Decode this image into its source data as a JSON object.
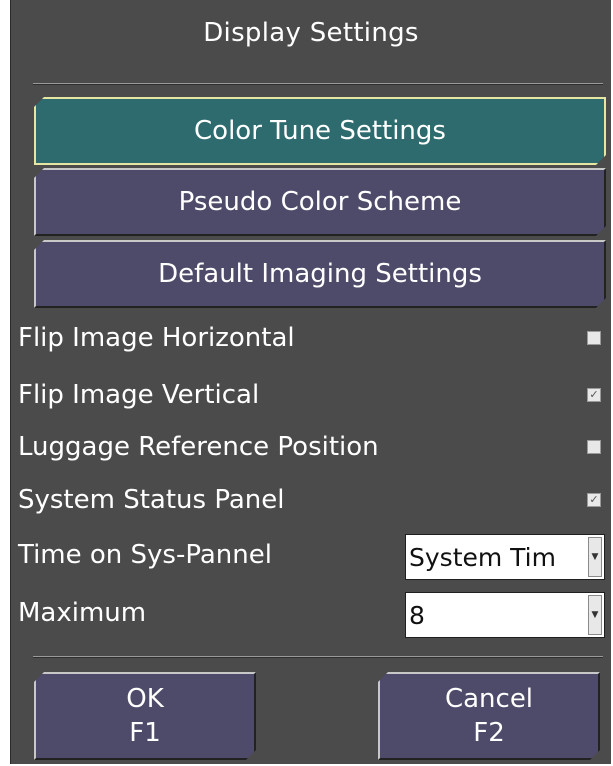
{
  "dialog": {
    "title": "Display Settings",
    "buttons": [
      {
        "label": "Color Tune Settings",
        "active": true
      },
      {
        "label": "Pseudo Color Scheme",
        "active": false
      },
      {
        "label": "Default Imaging Settings",
        "active": false
      }
    ],
    "options": [
      {
        "label": "Flip Image Horizontal",
        "checked": false
      },
      {
        "label": "Flip Image Vertical",
        "checked": true
      },
      {
        "label": "Luggage Reference Position",
        "checked": false
      },
      {
        "label": "System Status Panel",
        "checked": true
      }
    ],
    "time_on_sys_panel": {
      "label": "Time on Sys-Pannel",
      "value": "System Tim"
    },
    "maximum": {
      "label": "Maximum",
      "value": "8"
    },
    "ok": {
      "label": "OK",
      "key": "F1"
    },
    "cancel": {
      "label": "Cancel",
      "key": "F2"
    }
  },
  "icons": {
    "checkmark": "✓",
    "dropdown_arrow": "▼"
  },
  "colors": {
    "panel": "#4b4b4b",
    "button": "#4e4a6a",
    "active_button": "#2e6b6e",
    "active_border": "#e6e6a0"
  }
}
